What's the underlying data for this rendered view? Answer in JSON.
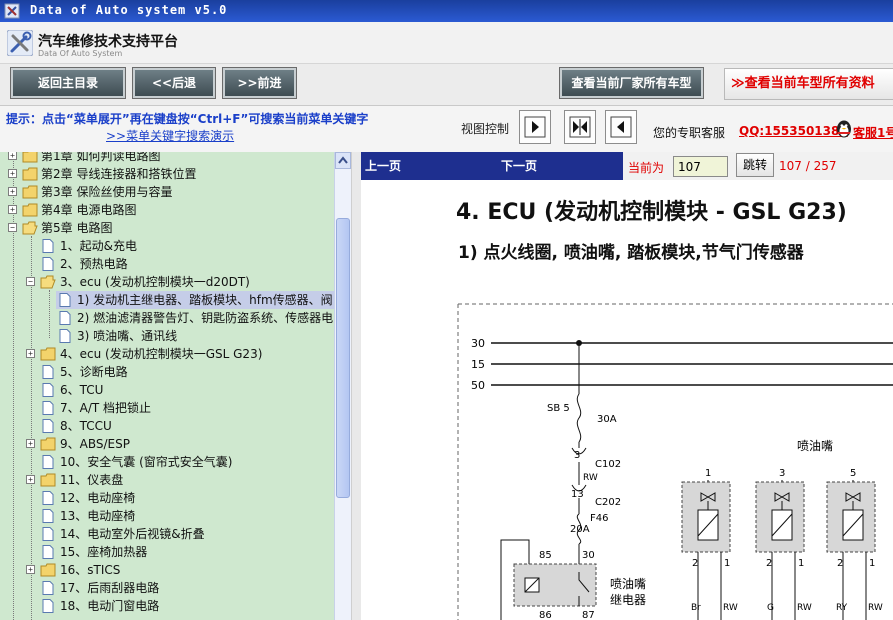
{
  "window": {
    "title": "Data of Auto system v5.0"
  },
  "brand": {
    "name": "汽车维修技术支持平台",
    "sub": "Data Of Auto System"
  },
  "toolbar": {
    "home": "返回主目录",
    "back": "<<后退",
    "forward": ">>前进",
    "maker_models": "查看当前厂家所有车型",
    "current_models": "≫查看当前车型所有资料"
  },
  "hint": {
    "text": "提示：点击“菜单展开”再在键盘按“Ctrl+F”可搜索当前菜单关键字",
    "link": ">>菜单关键字搜索演示"
  },
  "view": {
    "label": "视图控制"
  },
  "service": {
    "label": "您的专职客服",
    "qq": "QQ:1553501388",
    "kefu": "客服1号"
  },
  "tree": {
    "chapters": {
      "c1": "第1章  如何判读电路图",
      "c2": "第2章  导线连接器和搭铁位置",
      "c3": "第3章  保险丝使用与容量",
      "c4": "第4章  电源电路图",
      "c5": "第5章  电路图"
    },
    "items": {
      "i1": "1、起动&充电",
      "i2": "2、预热电路",
      "i3": "3、ecu (发动机控制模块一d20DT)",
      "i3a": "1) 发动机主继电器、踏板模块、hfm传感器、阀",
      "i3b": "2) 燃油滤清器警告灯、钥匙防盗系统、传感器电",
      "i3c": "3) 喷油嘴、通讯线",
      "i4": "4、ecu (发动机控制模块一GSL G23)",
      "i5": "5、诊断电路",
      "i6": "6、TCU",
      "i7": "7、A/T 档把锁止",
      "i8": "8、TCCU",
      "i9": "9、ABS/ESP",
      "i10": "10、安全气囊 (窗帘式安全气囊)",
      "i11": "11、仪表盘",
      "i12": "12、电动座椅",
      "i13": "13、电动座椅",
      "i14": "14、电动室外后视镜&折叠",
      "i15": "15、座椅加热器",
      "i16": "16、sTICS",
      "i17": "17、后雨刮器电路",
      "i18": "18、电动门窗电路"
    }
  },
  "nav": {
    "prev": "上一页",
    "next": "下一页",
    "current_label": "当前为",
    "page_value": "107",
    "go": "跳转",
    "count": "107 / 257"
  },
  "doc": {
    "title": "4. ECU (发动机控制模块 - GSL G23)",
    "subtitle": "1)  点火线圈, 喷油嘴, 踏板模块,节气门传感器"
  },
  "schematic": {
    "rail_30": "30",
    "rail_15": "15",
    "rail_50": "50",
    "fuse_name": "SB 5",
    "fuse_rating": "30A",
    "pin3": "3",
    "conn_c102": "C102",
    "wire_rw1": "RW",
    "pin13": "13",
    "conn_c202": "C202",
    "fuse2_name": "F46",
    "fuse2_rating": "20A",
    "relay_pin85": "85",
    "relay_pin30": "30",
    "relay_pin86": "86",
    "relay_pin87": "87",
    "relay_label1": "喷油嘴",
    "relay_label2": "继电器",
    "injector_title": "喷油嘴",
    "inj1_no": "1",
    "inj3_no": "3",
    "inj5_no": "5",
    "inj1_p2": "2",
    "inj1_p1": "1",
    "inj3_p2": "2",
    "inj3_p1": "1",
    "inj5_p2": "2",
    "inj5_p1": "1",
    "inj1_w1": "Br",
    "inj1_w2": "RW",
    "inj3_w1": "G",
    "inj3_w2": "RW",
    "inj5_w1": "RY",
    "inj5_w2": "RW"
  }
}
